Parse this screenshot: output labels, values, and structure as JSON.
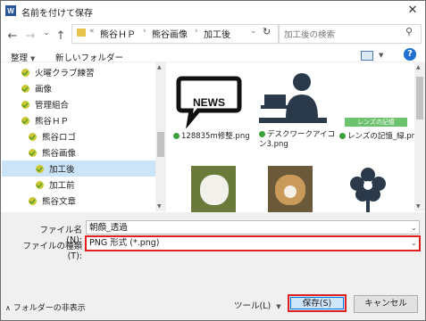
{
  "window": {
    "title": "名前を付けて保存",
    "app_icon": "W",
    "close": "✕"
  },
  "address": {
    "ellipsis": "«",
    "crumbs": [
      "熊谷ＨＰ",
      "熊谷画像",
      "加工後"
    ],
    "dropdown": "⌄",
    "refresh": "↻",
    "back": "←",
    "forward": "→",
    "expand": "⌄",
    "up": "↑"
  },
  "search": {
    "placeholder": "加工後の検索"
  },
  "toolbar": {
    "organize": "整理",
    "new_folder": "新しいフォルダー",
    "help": "?"
  },
  "tree": [
    {
      "label": "火曜クラブ練習"
    },
    {
      "label": "画像"
    },
    {
      "label": "管理組合"
    },
    {
      "label": "熊谷ＨＰ"
    },
    {
      "label": "熊谷ロゴ"
    },
    {
      "label": "熊谷画像"
    },
    {
      "label": "加工後"
    },
    {
      "label": "加工前"
    },
    {
      "label": "熊谷文章"
    }
  ],
  "files": [
    {
      "name": "128835m修整.png",
      "badge": "NEWS"
    },
    {
      "name": "デスクワークアイコン3.png"
    },
    {
      "name": "レンズの記憶_緑.png",
      "badge": "レンズの記憶"
    },
    {
      "name": ""
    },
    {
      "name": ""
    },
    {
      "name": ""
    }
  ],
  "form": {
    "filename_label": "ファイル名(N):",
    "filename_value": "朝顔_透過",
    "filetype_label": "ファイルの種類(T):",
    "filetype_value": "PNG 形式 (*.png)"
  },
  "footer": {
    "hide_folders": "フォルダーの非表示",
    "tools": "ツール(L)",
    "save": "保存(S)",
    "cancel": "キャンセル"
  },
  "colors": {
    "accent": "#0078d7",
    "highlight_red": "#e02020",
    "selection": "#cce4f7"
  }
}
